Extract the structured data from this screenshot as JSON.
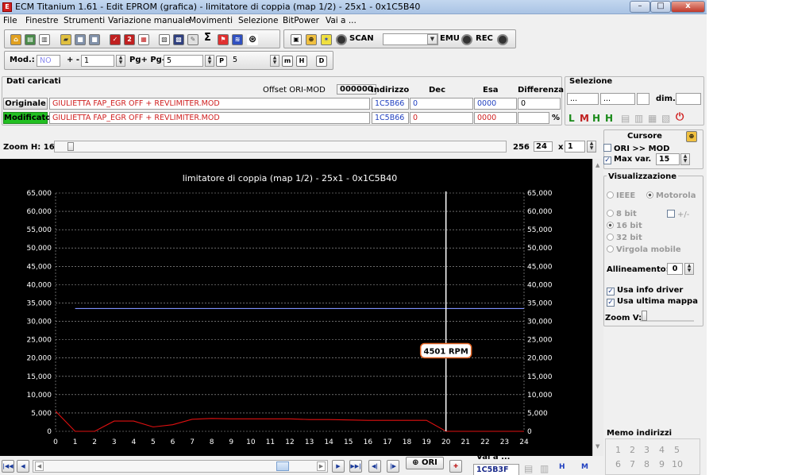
{
  "window": {
    "title": "ECM Titanium 1.61 - Edit EPROM (grafica) - limitatore di coppia (map 1/2) - 25x1 - 0x1C5B40",
    "minimize": "–",
    "maximize": "□",
    "close": "x"
  },
  "menu": [
    "File",
    "Finestre",
    "Strumenti",
    "Variazione manuale",
    "Movimenti",
    "Selezione",
    "BitPower",
    "Vai a ..."
  ],
  "toolbar": {
    "scan_label": "SCAN",
    "emu_label": "EMU",
    "rec_label": "REC",
    "sigma": "Σ"
  },
  "toolbar2": {
    "mod_label": "Mod.:",
    "mod_value": "NO",
    "plusminus_label": "+ -",
    "plusminus_value": "1",
    "pg_label": "Pg+ Pg-",
    "pg_value": "5",
    "p_value": "5"
  },
  "dati": {
    "header": "Dati caricati",
    "offset_label": "Offset ORI-MOD",
    "offset_value": "000000",
    "col_indirizzo": "Indirizzo",
    "col_dec": "Dec",
    "col_esa": "Esa",
    "col_diff": "Differenza",
    "originale_label": "Originale",
    "originale_file": "GIULIETTA FAP_EGR OFF + REVLIMITER.MOD",
    "originale_addr": "1C5B66",
    "originale_dec": "0",
    "originale_esa": "0000",
    "originale_diff": "0",
    "modificato_label": "Modificato",
    "modificato_file": "GIULIETTA FAP_EGR OFF + REVLIMITER.MOD",
    "modificato_addr": "1C5B66",
    "modificato_dec": "0",
    "modificato_esa": "0000",
    "pct": "%"
  },
  "selezione": {
    "header": "Selezione",
    "field1": "...",
    "field2": "...",
    "dim_label": "dim."
  },
  "zoom": {
    "label": "Zoom H: 16",
    "max": "256",
    "value": "24",
    "x_label": "x",
    "x_value": "1"
  },
  "cursore": {
    "header": "Cursore",
    "ori_mod": "ORI >> MOD",
    "max_var_label": "Max var.",
    "max_var_value": "15"
  },
  "visualizzazione": {
    "header": "Visualizzazione",
    "ieee": "IEEE",
    "motorola": "Motorola",
    "bit8": "8 bit",
    "plusminus": "+/-",
    "bit16": "16 bit",
    "bit32": "32 bit",
    "virgola": "Virgola mobile",
    "allineamento_label": "Allineamento:",
    "allineamento_value": "0",
    "usa_info": "Usa info driver",
    "usa_ultima": "Usa ultima mappa",
    "zoom_v": "Zoom V:"
  },
  "memo": {
    "header": "Memo indirizzi",
    "row1": [
      "1",
      "2",
      "3",
      "4",
      "5"
    ],
    "row2": [
      "6",
      "7",
      "8",
      "9",
      "10"
    ]
  },
  "bottom": {
    "ori_label": "ORI",
    "vai_label": "Vai a ...",
    "vai_value": "1C5B3F"
  },
  "colors": {
    "chart_bg": "#000000",
    "ori_series": "#7f93ff",
    "mod_series": "#e01010",
    "cursor": "#ffffff",
    "modificato_bg": "#22c022"
  },
  "chart_data": {
    "type": "line",
    "title": "limitatore di coppia (map 1/2) - 25x1 - 0x1C5B40",
    "x": [
      0,
      1,
      2,
      3,
      4,
      5,
      6,
      7,
      8,
      9,
      10,
      11,
      12,
      13,
      14,
      15,
      16,
      17,
      18,
      19,
      20,
      21,
      22,
      23,
      24
    ],
    "xlim": [
      0,
      24
    ],
    "ylim": [
      0,
      65000
    ],
    "y_ticks": [
      "0",
      "5,000",
      "10,000",
      "15,000",
      "20,000",
      "25,000",
      "30,000",
      "35,000",
      "40,000",
      "45,000",
      "50,000",
      "55,000",
      "60,000",
      "65,000"
    ],
    "grid": true,
    "series": [
      {
        "values": [
          5500,
          0,
          0,
          2800,
          2800,
          1200,
          1800,
          3300,
          3500,
          3400,
          3400,
          3400,
          3400,
          3200,
          3200,
          3100,
          3000,
          3000,
          3000,
          3000,
          0,
          0,
          0,
          0,
          0
        ]
      },
      {
        "values": [
          null,
          33500,
          33500,
          33500,
          33500,
          33500,
          33500,
          33500,
          33500,
          33500,
          33500,
          33500,
          33500,
          33500,
          33500,
          33500,
          33500,
          33500,
          33500,
          33500,
          33500,
          33500,
          33500,
          33500,
          33500
        ]
      }
    ],
    "cursor_x": 20,
    "annotation": "4501 RPM"
  }
}
